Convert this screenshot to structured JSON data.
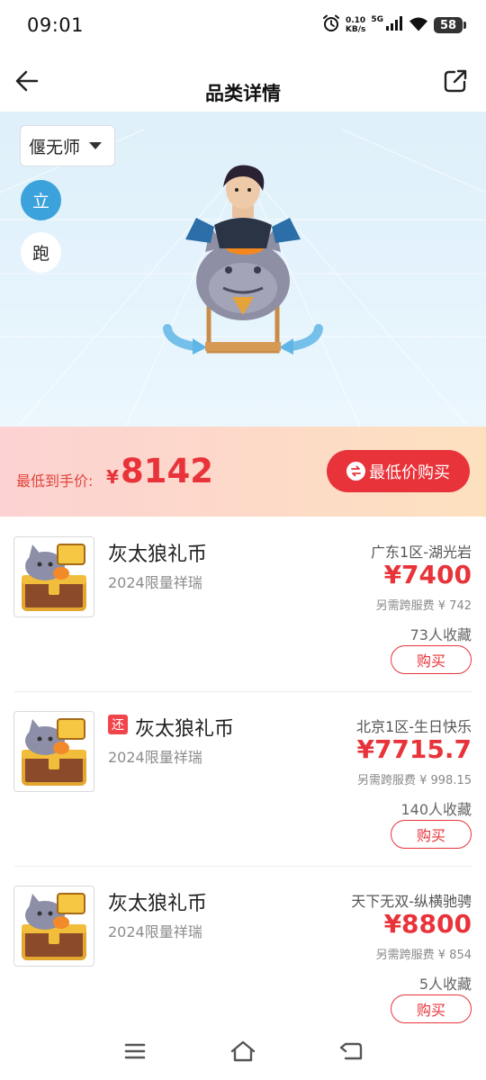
{
  "status_bar": {
    "time": "09:01",
    "net_speed_value": "0.10",
    "net_speed_unit": "KB/s",
    "signal_type": "5G",
    "battery": "58",
    "icons": [
      "alarm-icon",
      "signal-icon",
      "wifi-icon",
      "battery-icon"
    ]
  },
  "header": {
    "title": "品类详情",
    "back_icon": "arrow-left-icon",
    "share_icon": "share-external-icon"
  },
  "showcase": {
    "character_select": "偃无师",
    "pose_buttons": [
      "立",
      "跑"
    ],
    "active_pose": "立",
    "accent_color": "#3ca2dc"
  },
  "min_price": {
    "label": "最低到手价:",
    "currency": "¥",
    "value": "8142",
    "button_label": "最低价购买",
    "color": "#e8333a"
  },
  "listings": [
    {
      "name": "灰太狼礼币",
      "badge": "",
      "subtitle": "2024限量祥瑞",
      "server": "广东1区-湖光岩",
      "price": "¥7400",
      "fee": "另需跨服费 ¥ 742",
      "favorites": "73人收藏",
      "buy_label": "购买"
    },
    {
      "name": "灰太狼礼币",
      "badge": "还",
      "subtitle": "2024限量祥瑞",
      "server": "北京1区-生日快乐",
      "price": "¥7715.7",
      "fee": "另需跨服费 ¥ 998.15",
      "favorites": "140人收藏",
      "buy_label": "购买"
    },
    {
      "name": "灰太狼礼币",
      "badge": "",
      "subtitle": "2024限量祥瑞",
      "server": "天下无双-纵横驰骋",
      "price": "¥8800",
      "fee": "另需跨服费 ¥ 854",
      "favorites": "5人收藏",
      "buy_label": "购买"
    }
  ],
  "navbar": {
    "icons": [
      "menu-icon",
      "home-icon",
      "back-icon"
    ]
  }
}
